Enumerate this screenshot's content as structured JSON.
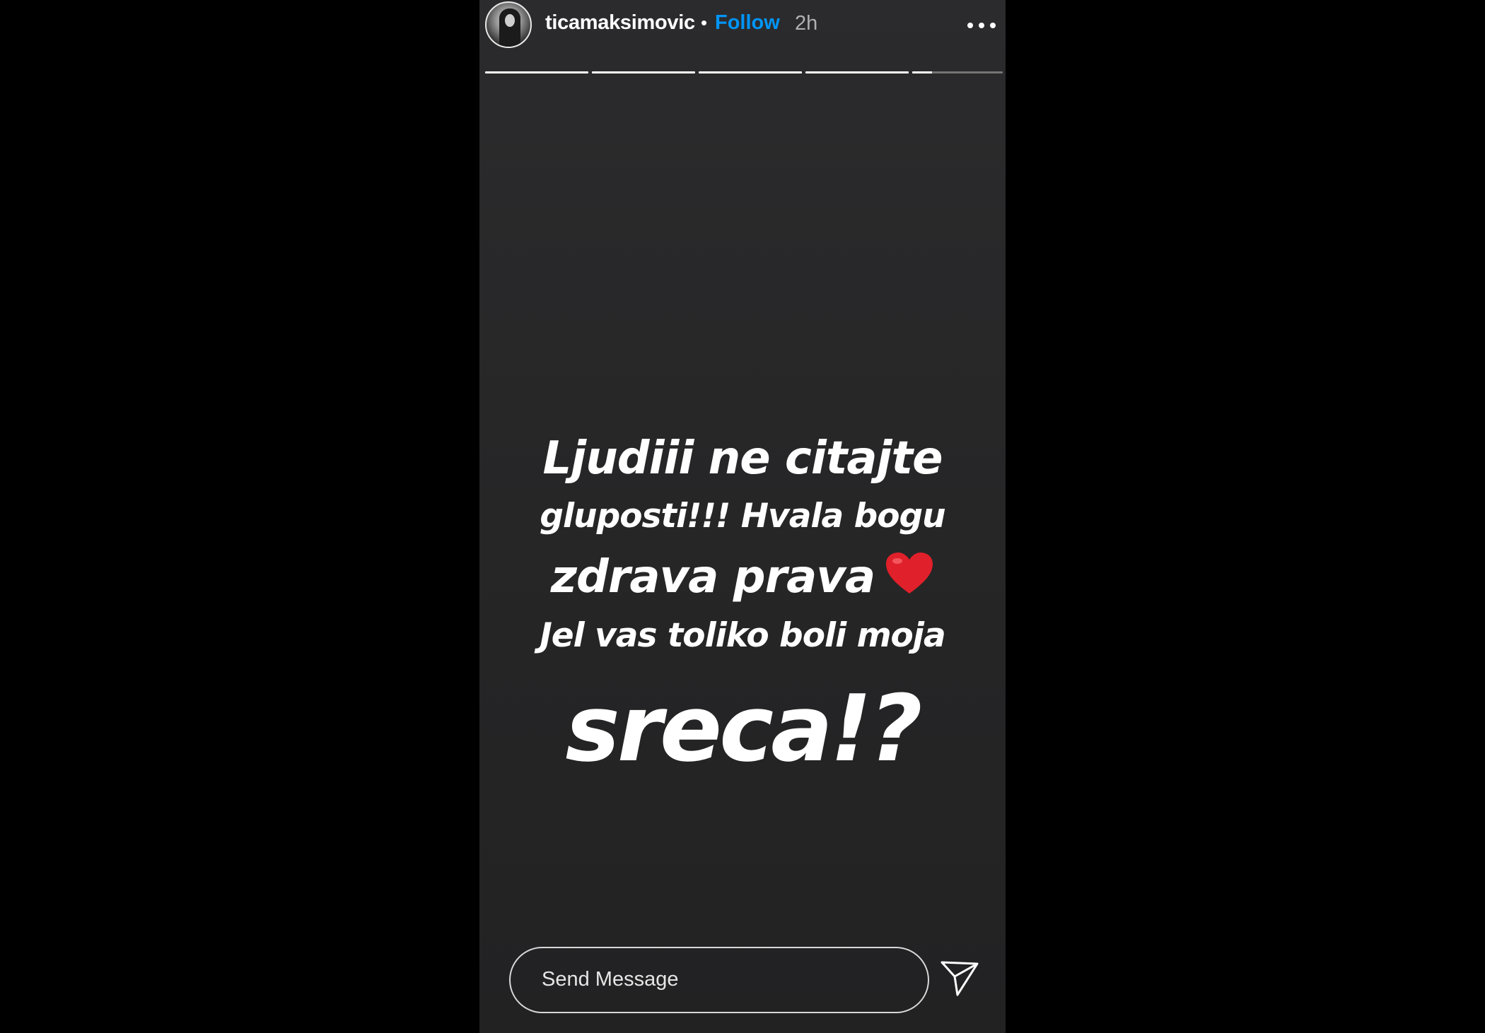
{
  "header": {
    "username": "ticamaksimovic",
    "separator": "•",
    "follow_label": "Follow",
    "time": "2h",
    "avatar_icon": "profile-avatar",
    "more_icon": "more-options-icon"
  },
  "progress": {
    "segments_total": 5,
    "current_segment": 5,
    "current_segment_progress": 0.22
  },
  "story": {
    "lines": [
      "Ljudiii ne citajte",
      "gluposti!!! Hvala bogu",
      "zdrava prava",
      "Jel vas toliko boli moja",
      "sreca!?"
    ],
    "emoji": "red-heart",
    "background_color": "#262627",
    "text_color": "#ffffff"
  },
  "composer": {
    "placeholder": "Send Message",
    "send_icon": "paper-plane-icon"
  },
  "colors": {
    "follow": "#0095f6",
    "page_background": "#000000"
  }
}
